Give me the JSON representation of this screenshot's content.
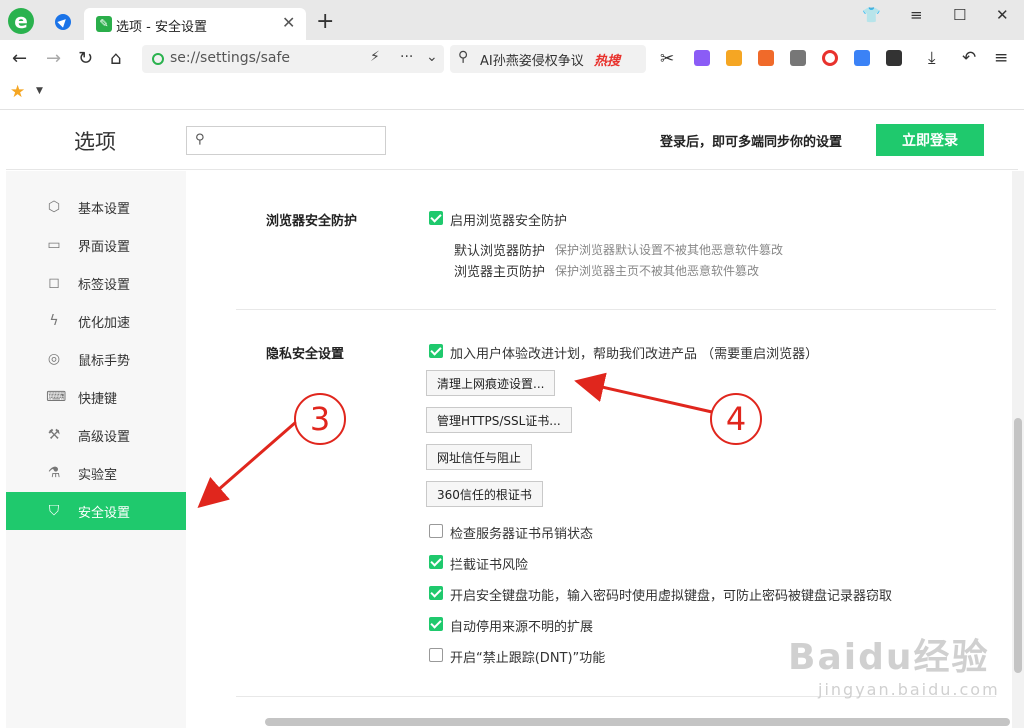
{
  "browser": {
    "tab_title": "选项 - 安全设置",
    "address": "se://settings/safe",
    "hot_search_text": "AI孙燕姿侵权争议",
    "hot_badge": "热搜"
  },
  "header": {
    "title": "选项",
    "search_placeholder": "",
    "login_tip": "登录后，即可多端同步你的设置",
    "login_button": "立即登录"
  },
  "sidebar": {
    "items": [
      {
        "label": "基本设置",
        "icon": "hexagon-icon",
        "active": false
      },
      {
        "label": "界面设置",
        "icon": "window-icon",
        "active": false
      },
      {
        "label": "标签设置",
        "icon": "tab-icon",
        "active": false
      },
      {
        "label": "优化加速",
        "icon": "lightning-icon",
        "active": false
      },
      {
        "label": "鼠标手势",
        "icon": "mouse-icon",
        "active": false
      },
      {
        "label": "快捷键",
        "icon": "keyboard-icon",
        "active": false
      },
      {
        "label": "高级设置",
        "icon": "wrench-icon",
        "active": false
      },
      {
        "label": "实验室",
        "icon": "flask-icon",
        "active": false
      },
      {
        "label": "安全设置",
        "icon": "shield-icon",
        "active": true
      }
    ]
  },
  "browser_protection": {
    "label": "浏览器安全防护",
    "enable_text": "启用浏览器安全防护",
    "enabled": true,
    "items": [
      {
        "title": "默认浏览器防护",
        "desc": "保护浏览器默认设置不被其他恶意软件篡改"
      },
      {
        "title": "浏览器主页防护",
        "desc": "保护浏览器主页不被其他恶意软件篡改"
      }
    ]
  },
  "privacy": {
    "label": "隐私安全设置",
    "join_program": "加入用户体验改进计划，帮助我们改进产品 （需要重启浏览器）",
    "buttons": {
      "clear_traces": "清理上网痕迹设置...",
      "manage_certs": "管理HTTPS/SSL证书...",
      "url_trust": "网址信任与阻止",
      "root_certs": "360信任的根证书"
    },
    "options": [
      {
        "text": "检查服务器证书吊销状态",
        "checked": false
      },
      {
        "text": "拦截证书风险",
        "checked": true
      },
      {
        "text": "开启安全键盘功能，输入密码时使用虚拟键盘，可防止密码被键盘记录器窃取",
        "checked": true
      },
      {
        "text": "自动停用来源不明的扩展",
        "checked": true
      },
      {
        "text": "开启“禁止跟踪(DNT)”功能",
        "checked": false
      }
    ]
  },
  "annotations": {
    "step3": "3",
    "step4": "4"
  },
  "watermark": {
    "big": "Baidu经验",
    "small": "jingyan.baidu.com"
  },
  "colors": {
    "accent": "#1fc96d",
    "annotation": "#e0261d"
  }
}
